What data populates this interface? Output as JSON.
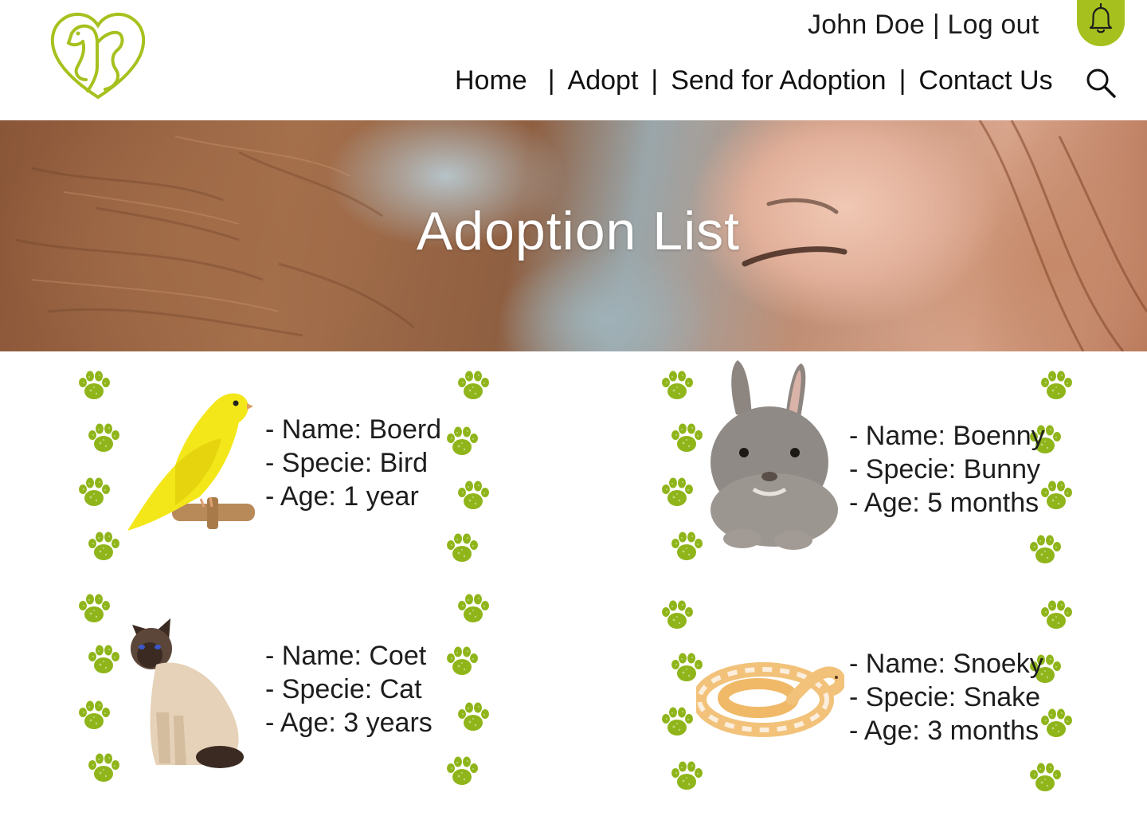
{
  "header": {
    "user_name": "John Doe",
    "separator": "|",
    "logout_label": "Log out",
    "nav": [
      {
        "label": "Home"
      },
      {
        "label": "Adopt"
      },
      {
        "label": "Send for Adoption"
      },
      {
        "label": "Contact Us"
      }
    ],
    "icons": {
      "logo": "pet-heart-logo",
      "notifications": "bell-icon",
      "search": "search-icon"
    }
  },
  "hero": {
    "title": "Adoption List"
  },
  "pets": [
    {
      "name_line": "- Name: Boerd",
      "specie_line": "- Specie: Bird",
      "age_line": "- Age: 1 year",
      "image": "canary"
    },
    {
      "name_line": "- Name: Boenny",
      "specie_line": "- Specie: Bunny",
      "age_line": "- Age: 5 months",
      "image": "rabbit"
    },
    {
      "name_line": "- Name: Coet",
      "specie_line": "- Specie: Cat",
      "age_line": "- Age: 3 years",
      "image": "siamese-cat"
    },
    {
      "name_line": "- Name: Snoeky",
      "specie_line": "- Specie: Snake",
      "age_line": "- Age: 3 months",
      "image": "python-snake"
    }
  ],
  "colors": {
    "accent": "#a6c11e",
    "paw": "#8fb51a",
    "text": "#1d1d1d"
  }
}
